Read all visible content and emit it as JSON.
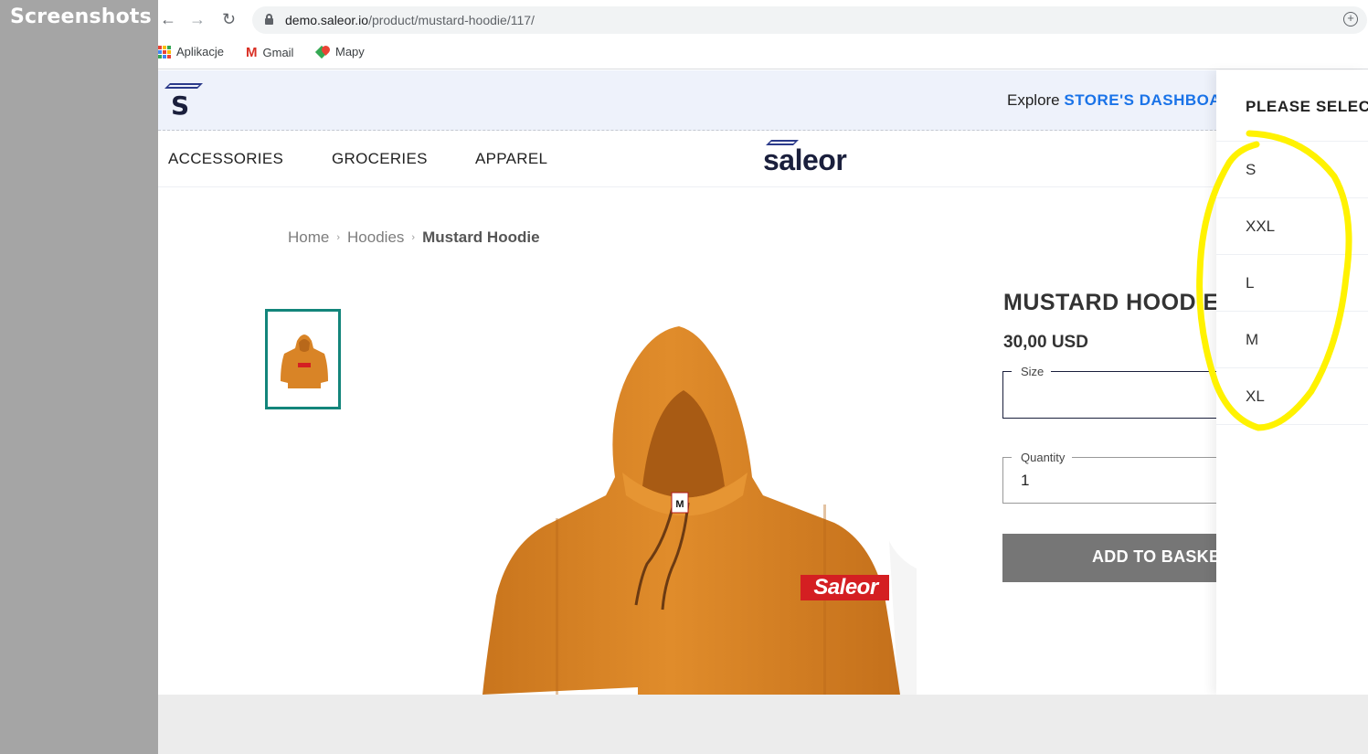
{
  "overlay_label": "Screenshots",
  "browser": {
    "url_domain": "demo.saleor.io",
    "url_path": "/product/mustard-hoodie/117/",
    "back_icon": "arrow-left-icon",
    "forward_icon": "arrow-right-icon",
    "reload_icon": "reload-icon",
    "bookmarks": [
      {
        "label": "Aplikacje",
        "icon": "apps-grid-icon"
      },
      {
        "label": "Gmail",
        "icon": "gmail-icon"
      },
      {
        "label": "Mapy",
        "icon": "maps-icon"
      }
    ]
  },
  "header": {
    "logo_letter": "S",
    "explore_text": "Explore",
    "explore_link": "STORE'S DASHBOARD",
    "brand": "saleor",
    "nav": [
      "ACCESSORIES",
      "GROCERIES",
      "APPAREL"
    ]
  },
  "breadcrumb": {
    "items": [
      "Home",
      "Hoodies"
    ],
    "current": "Mustard Hoodie"
  },
  "product": {
    "title": "MUSTARD HOODIE",
    "price": "30,00 USD",
    "size_label": "Size",
    "quantity_label": "Quantity",
    "quantity_value": "1",
    "add_to_basket": "ADD TO BASKET",
    "garment_print": "Saleor",
    "tag_letter": "M",
    "colors": {
      "hoodie": "#d98426",
      "print_bg": "#d41f22",
      "accent_teal": "#13857b"
    }
  },
  "size_dropdown": {
    "title": "PLEASE SELECT",
    "options": [
      "S",
      "XXL",
      "L",
      "M",
      "XL"
    ],
    "annotation_color": "#fff200"
  }
}
